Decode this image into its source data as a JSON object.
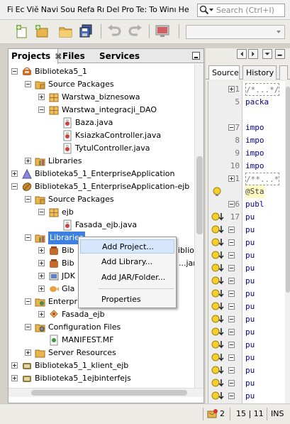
{
  "menubar": {
    "items": [
      "Fi",
      "Ec",
      "Viĕ",
      "Navi",
      "Sou",
      "Refa",
      "Rı",
      "Del",
      "Pro",
      "Te:",
      "To",
      "Winı",
      "He"
    ],
    "search_placeholder": "Search (Ctrl+I)"
  },
  "project_panel": {
    "tabs": [
      "Projects",
      "Files",
      "Services"
    ],
    "tab_close": "⌘",
    "tree": [
      "Biblioteka5_1",
      "Source Packages",
      "Warstwa_biznesowa",
      "Warstwa_integracji_DAO",
      "Baza.java",
      "KsiazkaController.java",
      "TytulController.java",
      "Libraries",
      "Biblioteka5_1_EnterpriseApplication",
      "Biblioteka5_1_EnterpriseApplication-ejb",
      "Source Packages",
      "ejb",
      "Fasada_ejb.java",
      "Libraries",
      "Bib",
      "Bib",
      "JDK",
      "Gla",
      "Enterpr",
      "Fasada_ejb",
      "Configuration Files",
      "MANIFEST.MF",
      "Server Resources",
      "Biblioteka5_1_klient_ejb",
      "Biblioteka5_1ejbinterfejs"
    ],
    "tree_behind_menu": [
      "ibliot",
      "...jar"
    ]
  },
  "context_menu": {
    "items": [
      "Add Project...",
      "Add Library...",
      "Add JAR/Folder...",
      "Properties"
    ]
  },
  "editor": {
    "tabs": [
      "Source",
      "History"
    ],
    "line_numbers": [
      "1",
      "5",
      "",
      "7",
      "8",
      "9",
      "10",
      "11",
      "",
      "16",
      "17",
      "",
      "",
      "",
      "",
      "",
      "",
      "",
      "",
      "",
      "",
      "",
      "",
      "",
      "",
      "30"
    ],
    "code_lines": [
      "/*...*/",
      "packa",
      "",
      "impo",
      "impo",
      "impo",
      "impo",
      "/**...*",
      "@Sta",
      "publ",
      "pu",
      "pu",
      "pu",
      "pu",
      "pu",
      "pu",
      "pu",
      "pu",
      "pu",
      "pu",
      "pu",
      "pu",
      "pu",
      "pu",
      "pu",
      "}"
    ]
  },
  "statusbar": {
    "notifications": "2",
    "position": "15 | 11",
    "mode": "INS"
  },
  "colors": {
    "selection": "#3d80df",
    "menu_highlight": "#d6e7fb"
  }
}
